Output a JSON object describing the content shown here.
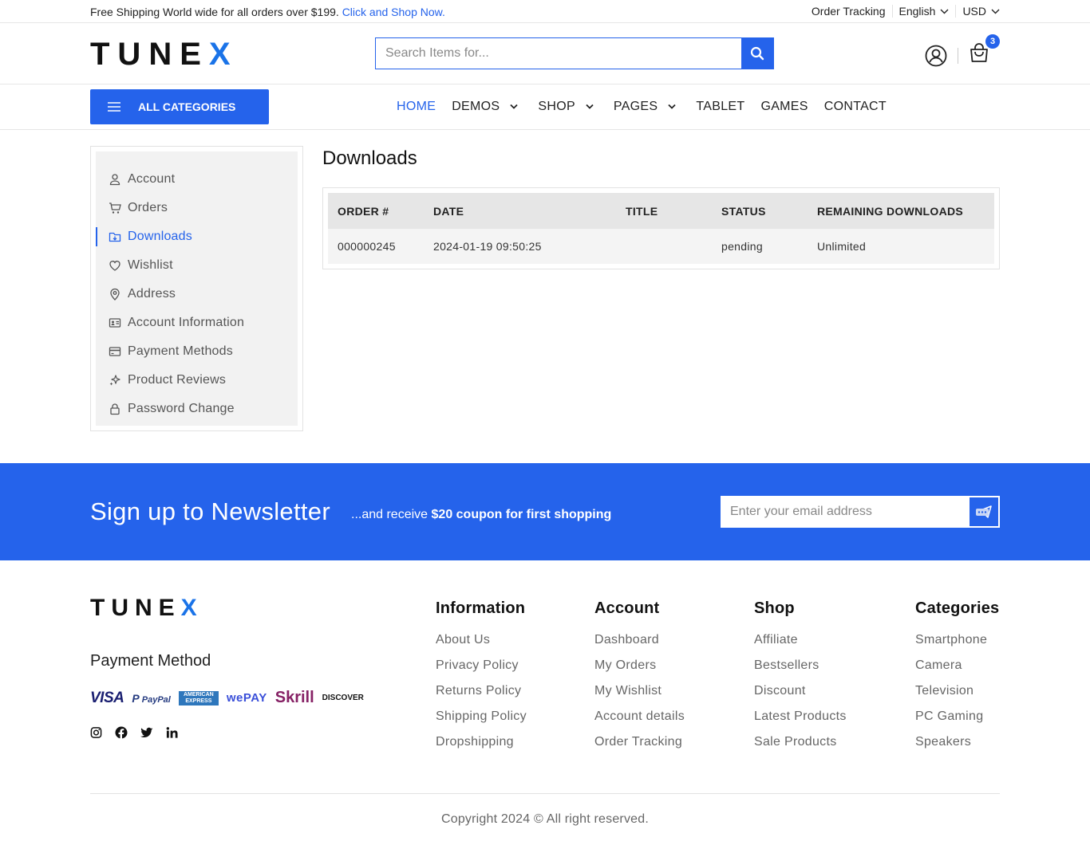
{
  "topbar": {
    "promo_text": "Free Shipping World wide for all orders over $199.",
    "promo_link": "Click and Shop Now.",
    "order_tracking": "Order Tracking",
    "language": "English",
    "currency": "USD"
  },
  "header": {
    "logo_main": "TUNE",
    "logo_accent": "X",
    "search_placeholder": "Search Items for...",
    "cart_count": "3"
  },
  "nav": {
    "all_categories": "ALL CATEGORIES",
    "items": [
      {
        "label": "HOME",
        "active": true
      },
      {
        "label": "DEMOS",
        "dropdown": true
      },
      {
        "label": "SHOP",
        "dropdown": true
      },
      {
        "label": "PAGES",
        "dropdown": true
      },
      {
        "label": "TABLET"
      },
      {
        "label": "GAMES"
      },
      {
        "label": "CONTACT"
      }
    ]
  },
  "sidebar": {
    "items": [
      {
        "label": "Account",
        "icon": "user-icon"
      },
      {
        "label": "Orders",
        "icon": "cart-icon"
      },
      {
        "label": "Downloads",
        "icon": "download-folder-icon",
        "active": true
      },
      {
        "label": "Wishlist",
        "icon": "heart-icon"
      },
      {
        "label": "Address",
        "icon": "location-pin-icon"
      },
      {
        "label": "Account Information",
        "icon": "id-card-icon"
      },
      {
        "label": "Payment Methods",
        "icon": "credit-card-icon"
      },
      {
        "label": "Product Reviews",
        "icon": "sparkle-icon"
      },
      {
        "label": "Password Change",
        "icon": "lock-icon"
      }
    ]
  },
  "main": {
    "title": "Downloads",
    "table": {
      "headers": [
        "ORDER #",
        "DATE",
        "TITLE",
        "STATUS",
        "REMAINING DOWNLOADS"
      ],
      "rows": [
        [
          "000000245",
          "2024-01-19 09:50:25",
          "",
          "pending",
          "Unlimited"
        ]
      ]
    }
  },
  "newsletter": {
    "title": "Sign up to Newsletter",
    "sub_prefix": "...and receive",
    "sub_bold": "$20 coupon for first shopping",
    "email_placeholder": "Enter your email address"
  },
  "footer": {
    "logo_main": "TUNE",
    "logo_accent": "X",
    "payment_title": "Payment Method",
    "payments": [
      "VISA",
      "PayPal",
      "AMERICAN EXPRESS",
      "wePAY",
      "Skrill",
      "DISCOVER"
    ],
    "columns": [
      {
        "title": "Information",
        "links": [
          "About Us",
          "Privacy Policy",
          "Returns Policy",
          "Shipping Policy",
          "Dropshipping"
        ]
      },
      {
        "title": "Account",
        "links": [
          "Dashboard",
          "My Orders",
          "My Wishlist",
          "Account details",
          "Order Tracking"
        ]
      },
      {
        "title": "Shop",
        "links": [
          "Affiliate",
          "Bestsellers",
          "Discount",
          "Latest Products",
          "Sale Products"
        ]
      },
      {
        "title": "Categories",
        "links": [
          "Smartphone",
          "Camera",
          "Television",
          "PC Gaming",
          "Speakers"
        ]
      }
    ],
    "copyright": "Copyright 2024 © All right reserved."
  },
  "colors": {
    "primary": "#2563eb",
    "sidebar_bg": "#f2f2f2"
  }
}
